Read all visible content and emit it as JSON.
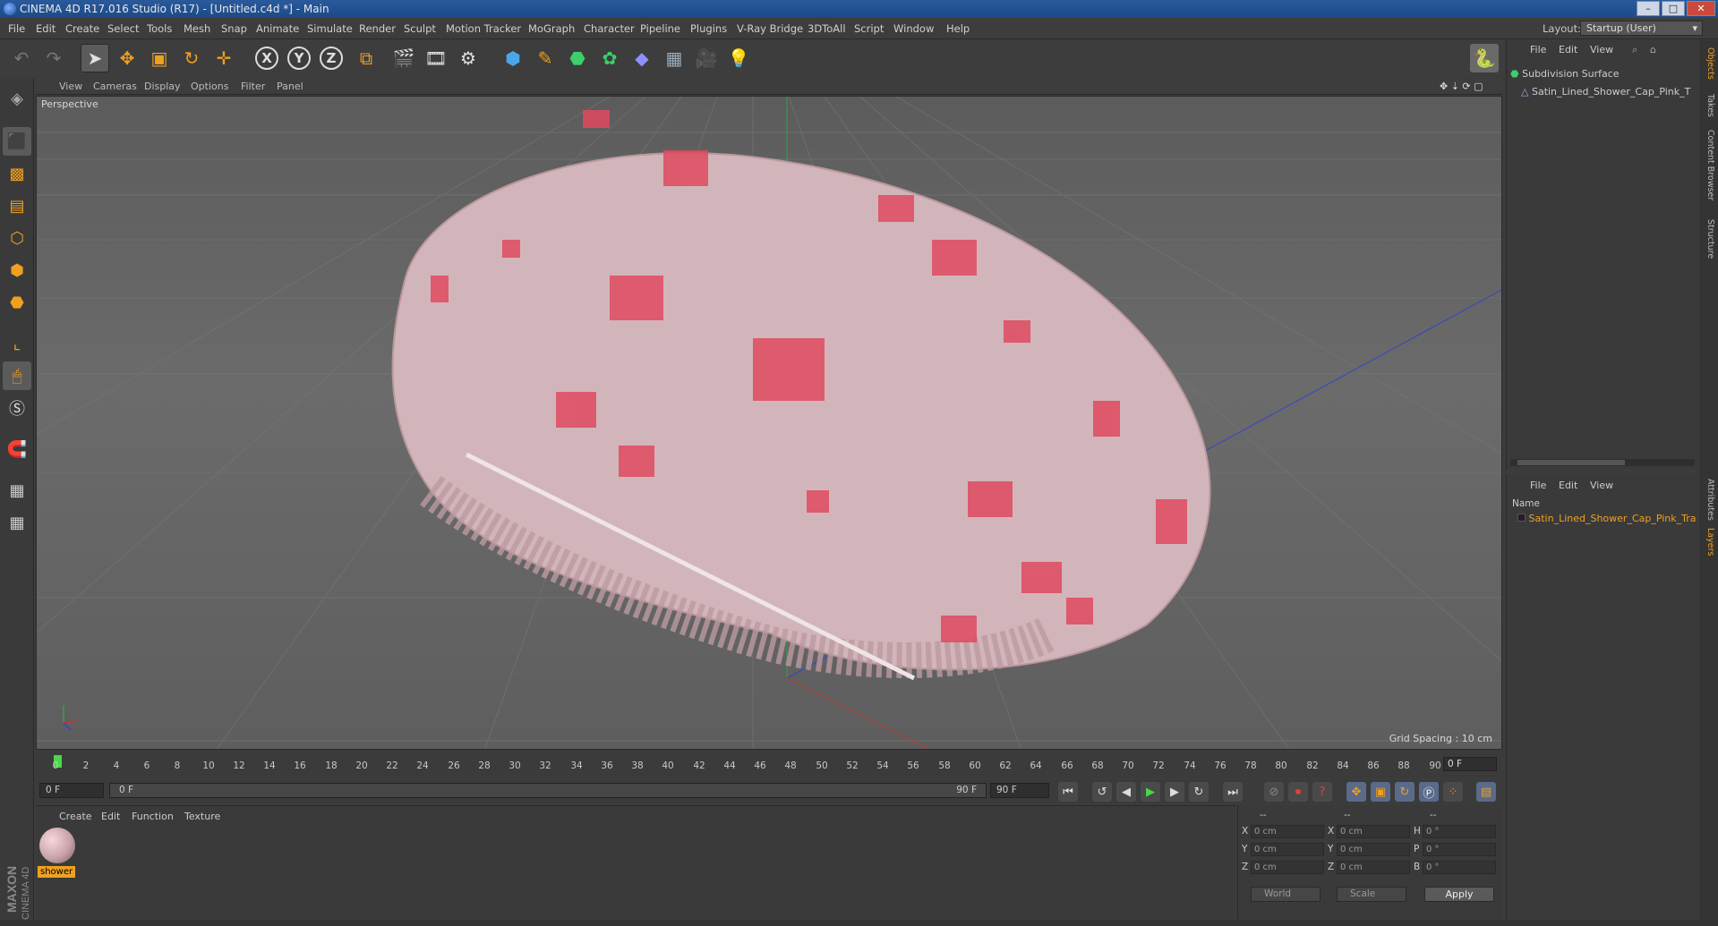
{
  "window": {
    "title": "CINEMA 4D R17.016 Studio (R17) - [Untitled.c4d *] - Main"
  },
  "menu": [
    "File",
    "Edit",
    "Create",
    "Select",
    "Tools",
    "Mesh",
    "Snap",
    "Animate",
    "Simulate",
    "Render",
    "Sculpt",
    "Motion Tracker",
    "MoGraph",
    "Character",
    "Pipeline",
    "Plugins",
    "V-Ray Bridge",
    "3DToAll",
    "Script",
    "Window",
    "Help"
  ],
  "layout": {
    "label": "Layout:",
    "value": "Startup (User)"
  },
  "viewport": {
    "menu": [
      "View",
      "Cameras",
      "Display",
      "Options",
      "Filter",
      "Panel"
    ],
    "label": "Perspective",
    "grid_spacing": "Grid Spacing : 10 cm"
  },
  "timeline": {
    "ticks": [
      "0",
      "2",
      "4",
      "6",
      "8",
      "10",
      "12",
      "14",
      "16",
      "18",
      "20",
      "22",
      "24",
      "26",
      "28",
      "30",
      "32",
      "34",
      "36",
      "38",
      "40",
      "42",
      "44",
      "46",
      "48",
      "50",
      "52",
      "54",
      "56",
      "58",
      "60",
      "62",
      "64",
      "66",
      "68",
      "70",
      "72",
      "74",
      "76",
      "78",
      "80",
      "82",
      "84",
      "86",
      "88",
      "90"
    ],
    "current_frame": "0 F",
    "start_field": "0 F",
    "range_start": "0 F",
    "range_end": "90 F",
    "end_field": "90 F"
  },
  "material_manager": {
    "menu": [
      "Create",
      "Edit",
      "Function",
      "Texture"
    ],
    "material_name": "shower"
  },
  "coordinates": {
    "header": [
      "--",
      "--",
      "--"
    ],
    "rows": [
      {
        "a": "X",
        "a_val": "0 cm",
        "b": "X",
        "b_val": "0 cm",
        "c": "H",
        "c_val": "0 °"
      },
      {
        "a": "Y",
        "a_val": "0 cm",
        "b": "Y",
        "b_val": "0 cm",
        "c": "P",
        "c_val": "0 °"
      },
      {
        "a": "Z",
        "a_val": "0 cm",
        "b": "Z",
        "b_val": "0 cm",
        "c": "B",
        "c_val": "0 °"
      }
    ],
    "mode1": "World",
    "mode2": "Scale",
    "apply": "Apply"
  },
  "object_manager": {
    "menu": [
      "File",
      "Edit",
      "View"
    ],
    "items": [
      "Subdivision Surface",
      "Satin_Lined_Shower_Cap_Pink_T"
    ]
  },
  "layer_manager": {
    "menu": [
      "File",
      "Edit",
      "View"
    ],
    "column": "Name",
    "items": [
      "Satin_Lined_Shower_Cap_Pink_Tra"
    ]
  },
  "side_tabs": [
    "Objects",
    "Takes",
    "Content Browser",
    "Structure",
    "Attributes",
    "Layers"
  ],
  "branding": [
    "MAXON",
    "CINEMA 4D"
  ],
  "colors": {
    "accent": "#f0a020",
    "titlebar": "#1c4a88",
    "playhead": "#48d848"
  }
}
